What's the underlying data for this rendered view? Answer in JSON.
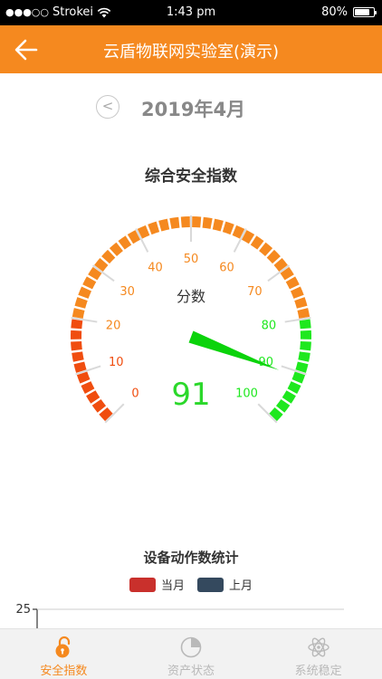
{
  "status_bar": {
    "signal_dots": "●●●○○",
    "carrier": "Strokei",
    "time": "1:43 pm",
    "battery": "80%",
    "battery_level": 0.8
  },
  "nav": {
    "title": "云盾物联网实验室(演示)",
    "back_icon": "arrow-left-icon"
  },
  "month": {
    "prev_label": "<",
    "label": "2019年4月"
  },
  "gauge": {
    "title": "综合安全指数",
    "center_label": "分数",
    "value": 91,
    "min": 0,
    "max": 100,
    "ticks": [
      "0",
      "10",
      "20",
      "30",
      "40",
      "50",
      "60",
      "70",
      "80",
      "90",
      "100"
    ],
    "colors": {
      "low": "#f04d0f",
      "mid": "#f5891f",
      "high": "#1ee81e",
      "value_text": "#2bd82b",
      "needle": "#0bd30b"
    }
  },
  "device_chart": {
    "title": "设备动作数统计",
    "legend": [
      {
        "name": "当月",
        "color": "#c9302c"
      },
      {
        "name": "上月",
        "color": "#34495e"
      }
    ],
    "y_axis_top_label": "25"
  },
  "tabs": [
    {
      "label": "安全指数",
      "icon": "lock-icon",
      "active": true
    },
    {
      "label": "资产状态",
      "icon": "pie-chart-icon",
      "active": false
    },
    {
      "label": "系统稳定",
      "icon": "atom-icon",
      "active": false
    }
  ],
  "accent_color": "#f5891f"
}
